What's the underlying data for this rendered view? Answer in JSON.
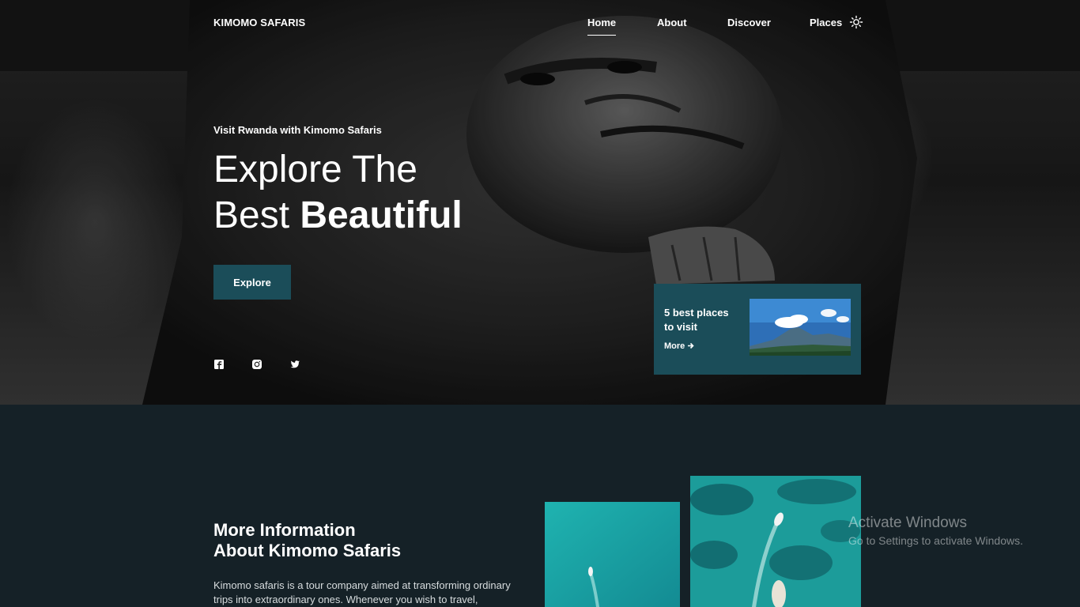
{
  "brand": "KIMOMO SAFARIS",
  "nav": {
    "items": [
      "Home",
      "About",
      "Discover",
      "Places"
    ],
    "active": "Home",
    "theme_toggle_icon": "sun-icon"
  },
  "hero": {
    "subtitle": "Visit Rwanda with Kimomo Safaris",
    "headline_line1": "Explore The",
    "headline_line2_plain": "Best ",
    "headline_line2_bold": "Beautiful",
    "explore_label": "Explore",
    "socials": [
      "facebook-icon",
      "instagram-icon",
      "twitter-icon"
    ]
  },
  "card": {
    "title": "5 best places to visit",
    "more_label": "More",
    "more_icon": "arrow-right-icon"
  },
  "about": {
    "title_line1": "More Information",
    "title_line2": "About Kimomo Safaris",
    "text": "Kimomo safaris is a tour company aimed at transforming ordinary trips into extraordinary ones. Whenever you wish to travel,"
  },
  "watermark": {
    "line1": "Activate Windows",
    "line2": "Go to Settings to activate Windows."
  },
  "colors": {
    "accent": "#1b4d59",
    "section_bg": "#152127",
    "sea": "#1fa3a3"
  }
}
